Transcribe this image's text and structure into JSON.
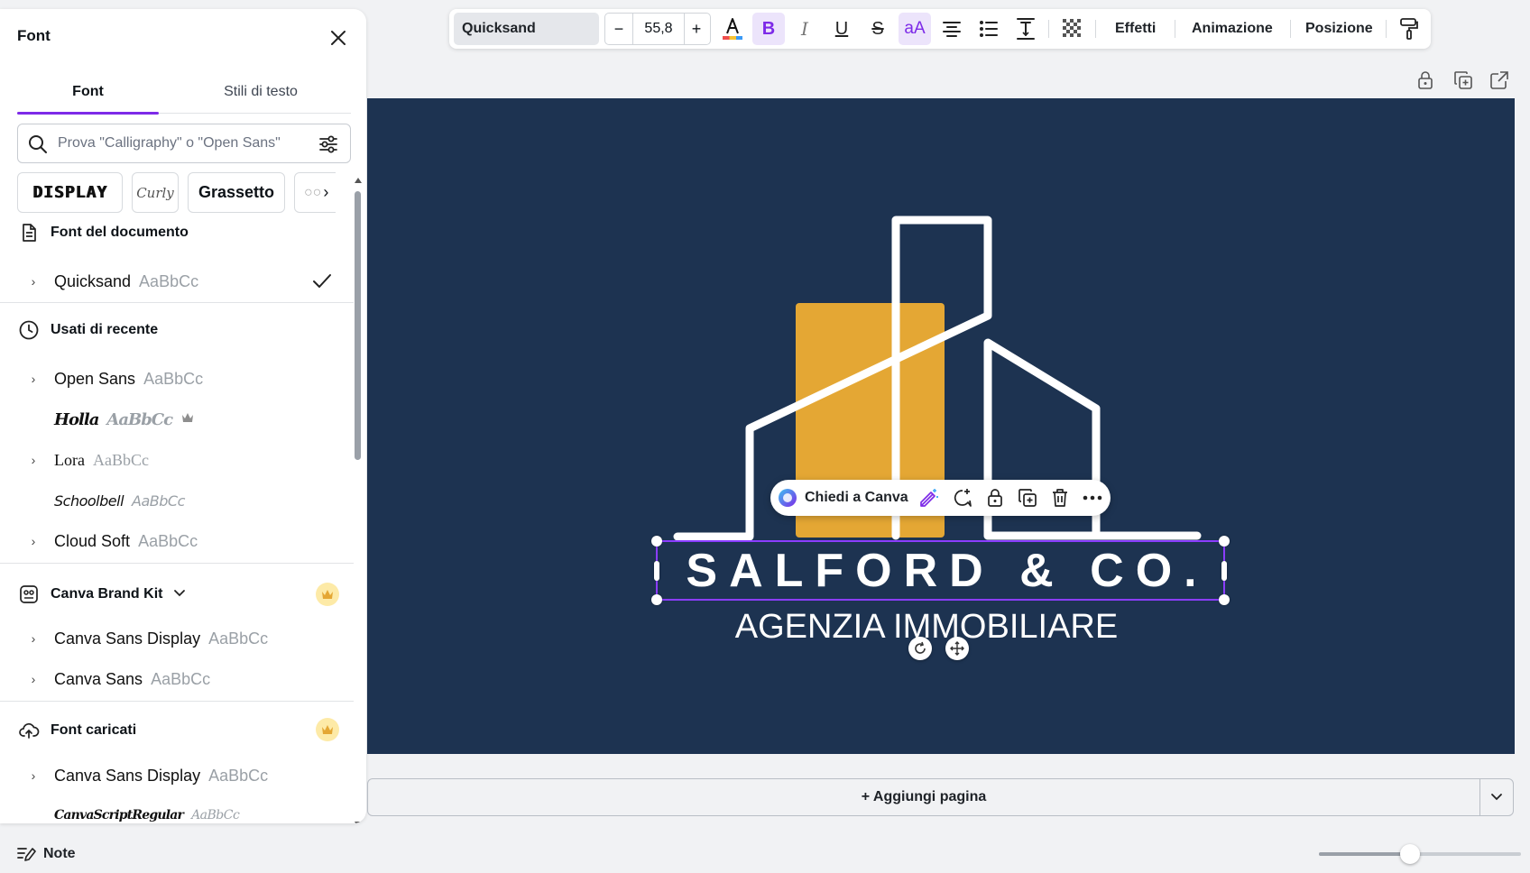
{
  "panel": {
    "title": "Font",
    "tabs": [
      {
        "label": "Font",
        "active": true
      },
      {
        "label": "Stili di testo",
        "active": false
      }
    ],
    "search_placeholder": "Prova \"Calligraphy\" o \"Open Sans\"",
    "chips": [
      "DISPLAY",
      "Curly",
      "Grassetto"
    ],
    "document_fonts": {
      "heading": "Font del documento",
      "items": [
        {
          "name": "Quicksand",
          "sample": "AaBbCc",
          "selected": true
        }
      ]
    },
    "recent": {
      "heading": "Usati di recente",
      "items": [
        {
          "name": "Open Sans",
          "sample": "AaBbCc"
        },
        {
          "name": "Holla",
          "sample": "AaBbCc",
          "premium": true
        },
        {
          "name": "Lora",
          "sample": "AaBbCc"
        },
        {
          "name": "Schoolbell",
          "sample": "AaBbCc"
        },
        {
          "name": "Cloud Soft",
          "sample": "AaBbCc"
        }
      ]
    },
    "brand_kit": {
      "heading": "Canva Brand Kit",
      "items": [
        {
          "name": "Canva Sans Display",
          "sample": "AaBbCc"
        },
        {
          "name": "Canva Sans",
          "sample": "AaBbCc"
        }
      ]
    },
    "uploaded": {
      "heading": "Font caricati",
      "items": [
        {
          "name": "Canva Sans Display",
          "sample": "AaBbCc"
        },
        {
          "name": "CanvaScriptRegular",
          "sample": "AaBbCc"
        }
      ]
    }
  },
  "toolbar": {
    "font": "Quicksand",
    "size_minus": "−",
    "size": "55,8",
    "size_plus": "+",
    "effects": "Effetti",
    "animation": "Animazione",
    "position": "Posizione"
  },
  "design": {
    "title": "SALFORD & CO.",
    "subtitle": "AGENZIA IMMOBILIARE",
    "colors": {
      "background": "#1d3351",
      "accent": "#e4a734",
      "lines": "#ffffff",
      "selection": "#8b3dff"
    }
  },
  "context_toolbar": {
    "ask_label": "Chiedi a Canva"
  },
  "add_page_label": "+ Aggiungi pagina",
  "notes_label": "Note",
  "zoom": {
    "fraction": 0.45
  }
}
